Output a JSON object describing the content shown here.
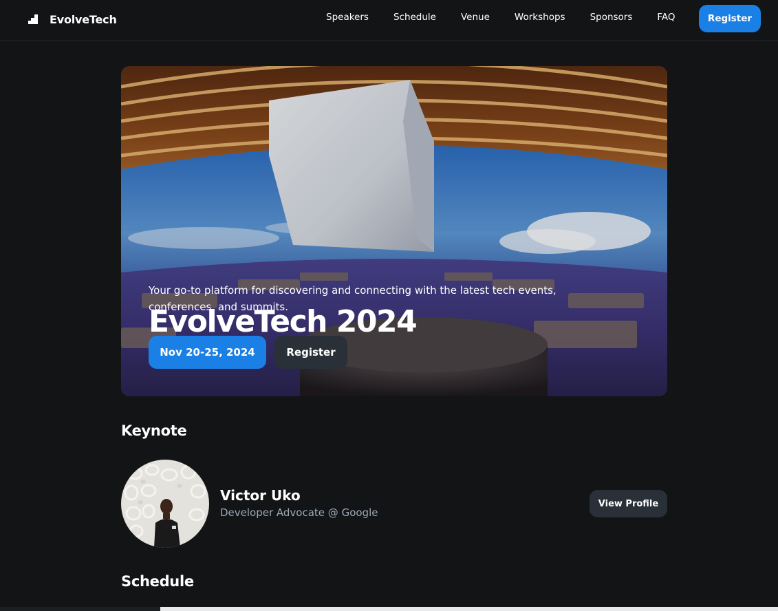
{
  "header": {
    "brand": "EvolveTech",
    "nav": [
      "Speakers",
      "Schedule",
      "Venue",
      "Workshops",
      "Sponsors",
      "FAQ"
    ],
    "register_label": "Register"
  },
  "hero": {
    "title": "EvolveTech 2024",
    "subtitle": "Your go-to platform for discovering and connecting with the latest tech events, conferences, and summits.",
    "date_label": "Nov 20-25, 2024",
    "register_label": "Register"
  },
  "keynote": {
    "heading": "Keynote",
    "speaker_name": "Victor Uko",
    "speaker_role": "Developer Advocate @ Google",
    "profile_label": "View Profile"
  },
  "schedule": {
    "heading": "Schedule"
  },
  "colors": {
    "background": "#121416",
    "accent": "#1a80e5",
    "secondary_button": "#293038",
    "muted_text": "#9dabb8"
  }
}
